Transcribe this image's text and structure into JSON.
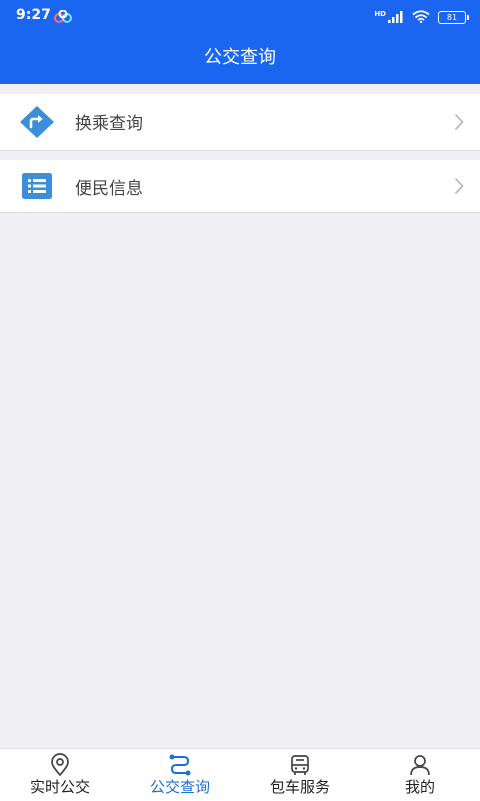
{
  "status_bar": {
    "time": "9:27",
    "network_label": "HD",
    "battery_level": "81",
    "icons": [
      "app-notification-icon",
      "signal-icon",
      "wifi-icon",
      "battery-icon"
    ]
  },
  "header": {
    "title": "公交查询"
  },
  "menu": {
    "items": [
      {
        "label": "换乘查询",
        "icon": "transfer-route-icon",
        "accent": "#3b8fd9"
      },
      {
        "label": "便民信息",
        "icon": "info-list-icon",
        "accent": "#3b8fd9"
      }
    ]
  },
  "tabbar": {
    "active_index": 1,
    "active_color": "#1a6fd8",
    "tabs": [
      {
        "label": "实时公交",
        "icon": "location-pin-icon"
      },
      {
        "label": "公交查询",
        "icon": "route-icon"
      },
      {
        "label": "包车服务",
        "icon": "bus-icon"
      },
      {
        "label": "我的",
        "icon": "user-icon"
      }
    ]
  },
  "colors": {
    "primary": "#1a66f0",
    "background": "#efeff4"
  }
}
